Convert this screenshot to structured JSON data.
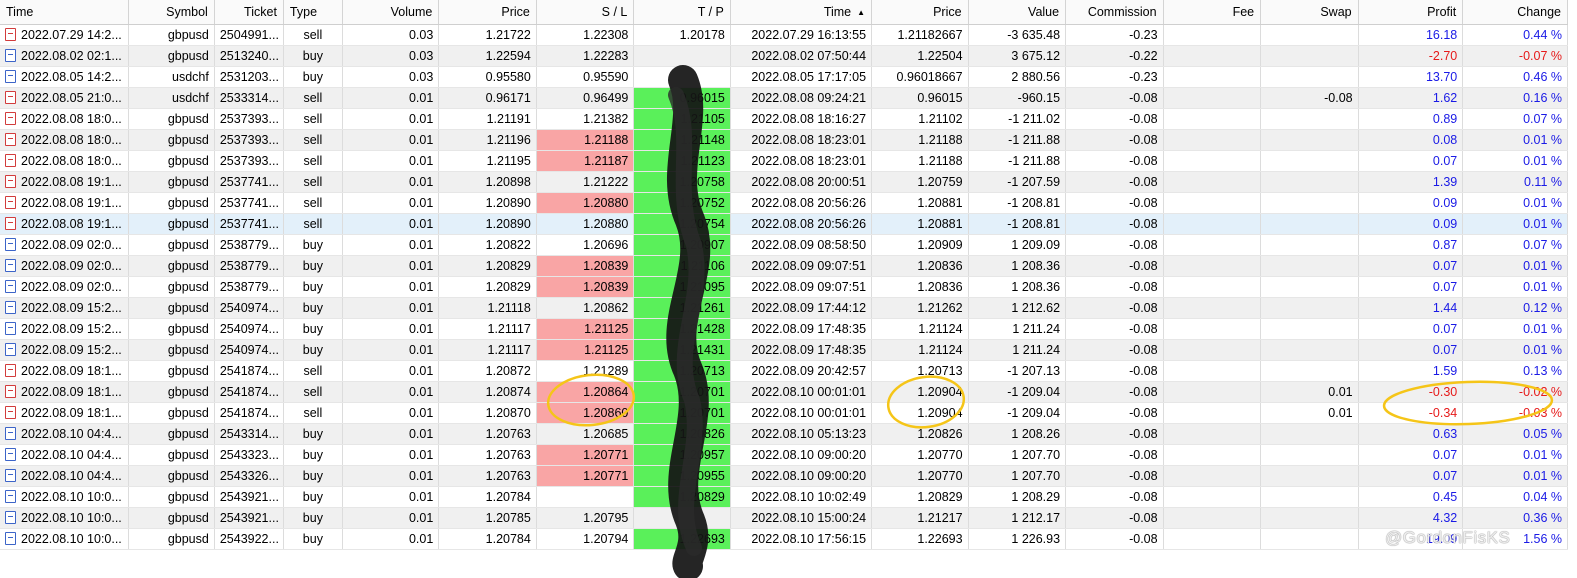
{
  "headers": {
    "time": "Time",
    "symbol": "Symbol",
    "ticket": "Ticket",
    "type": "Type",
    "volume": "Volume",
    "price": "Price",
    "sl": "S / L",
    "tp": "T / P",
    "time2": "Time",
    "price2": "Price",
    "value": "Value",
    "commission": "Commission",
    "fee": "Fee",
    "swap": "Swap",
    "profit": "Profit",
    "change": "Change"
  },
  "sort_indicator": "▲",
  "rows": [
    {
      "time": "2022.07.29 14:2...",
      "symbol": "gbpusd",
      "ticket": "2504991...",
      "type": "sell",
      "volume": "0.03",
      "price": "1.21722",
      "sl": "1.22308",
      "tp": "1.20178",
      "time2": "2022.07.29 16:13:55",
      "price2": "1.21182667",
      "value": "-3 635.48",
      "commission": "-0.23",
      "fee": "",
      "swap": "",
      "profit": "16.18",
      "change": "0.44 %"
    },
    {
      "time": "2022.08.02 02:1...",
      "symbol": "gbpusd",
      "ticket": "2513240...",
      "type": "buy",
      "volume": "0.03",
      "price": "1.22594",
      "sl": "1.22283",
      "tp": "",
      "time2": "2022.08.02 07:50:44",
      "price2": "1.22504",
      "value": "3 675.12",
      "commission": "-0.22",
      "fee": "",
      "swap": "",
      "profit": "-2.70",
      "change": "-0.07 %"
    },
    {
      "time": "2022.08.05 14:2...",
      "symbol": "usdchf",
      "ticket": "2531203...",
      "type": "buy",
      "volume": "0.03",
      "price": "0.95580",
      "sl": "0.95590",
      "tp": "",
      "time2": "2022.08.05 17:17:05",
      "price2": "0.96018667",
      "value": "2 880.56",
      "commission": "-0.23",
      "fee": "",
      "swap": "",
      "profit": "13.70",
      "change": "0.46 %"
    },
    {
      "time": "2022.08.05 21:0...",
      "symbol": "usdchf",
      "ticket": "2533314...",
      "type": "sell",
      "volume": "0.01",
      "price": "0.96171",
      "sl": "0.96499",
      "tp": "0.96015",
      "time2": "2022.08.08 09:24:21",
      "price2": "0.96015",
      "value": "-960.15",
      "commission": "-0.08",
      "fee": "",
      "swap": "-0.08",
      "profit": "1.62",
      "change": "0.16 %"
    },
    {
      "time": "2022.08.08 18:0...",
      "symbol": "gbpusd",
      "ticket": "2537393...",
      "type": "sell",
      "volume": "0.01",
      "price": "1.21191",
      "sl": "1.21382",
      "tp": "1.21105",
      "time2": "2022.08.08 18:16:27",
      "price2": "1.21102",
      "value": "-1 211.02",
      "commission": "-0.08",
      "fee": "",
      "swap": "",
      "profit": "0.89",
      "change": "0.07 %"
    },
    {
      "time": "2022.08.08 18:0...",
      "symbol": "gbpusd",
      "ticket": "2537393...",
      "type": "sell",
      "volume": "0.01",
      "price": "1.21196",
      "sl": "1.21188",
      "tp": "1.21148",
      "time2": "2022.08.08 18:23:01",
      "price2": "1.21188",
      "value": "-1 211.88",
      "commission": "-0.08",
      "fee": "",
      "swap": "",
      "profit": "0.08",
      "change": "0.01 %"
    },
    {
      "time": "2022.08.08 18:0...",
      "symbol": "gbpusd",
      "ticket": "2537393...",
      "type": "sell",
      "volume": "0.01",
      "price": "1.21195",
      "sl": "1.21187",
      "tp": "1.21123",
      "time2": "2022.08.08 18:23:01",
      "price2": "1.21188",
      "value": "-1 211.88",
      "commission": "-0.08",
      "fee": "",
      "swap": "",
      "profit": "0.07",
      "change": "0.01 %"
    },
    {
      "time": "2022.08.08 19:1...",
      "symbol": "gbpusd",
      "ticket": "2537741...",
      "type": "sell",
      "volume": "0.01",
      "price": "1.20898",
      "sl": "1.21222",
      "tp": "1.20758",
      "time2": "2022.08.08 20:00:51",
      "price2": "1.20759",
      "value": "-1 207.59",
      "commission": "-0.08",
      "fee": "",
      "swap": "",
      "profit": "1.39",
      "change": "0.11 %"
    },
    {
      "time": "2022.08.08 19:1...",
      "symbol": "gbpusd",
      "ticket": "2537741...",
      "type": "sell",
      "volume": "0.01",
      "price": "1.20890",
      "sl": "1.20880",
      "tp": "1.20752",
      "time2": "2022.08.08 20:56:26",
      "price2": "1.20881",
      "value": "-1 208.81",
      "commission": "-0.08",
      "fee": "",
      "swap": "",
      "profit": "0.09",
      "change": "0.01 %"
    },
    {
      "time": "2022.08.08 19:1...",
      "symbol": "gbpusd",
      "ticket": "2537741...",
      "type": "sell",
      "volume": "0.01",
      "price": "1.20890",
      "sl": "1.20880",
      "tp": "1.20754",
      "time2": "2022.08.08 20:56:26",
      "price2": "1.20881",
      "value": "-1 208.81",
      "commission": "-0.08",
      "fee": "",
      "swap": "",
      "profit": "0.09",
      "change": "0.01 %"
    },
    {
      "time": "2022.08.09 02:0...",
      "symbol": "gbpusd",
      "ticket": "2538779...",
      "type": "buy",
      "volume": "0.01",
      "price": "1.20822",
      "sl": "1.20696",
      "tp": "1.20907",
      "time2": "2022.08.09 08:58:50",
      "price2": "1.20909",
      "value": "1 209.09",
      "commission": "-0.08",
      "fee": "",
      "swap": "",
      "profit": "0.87",
      "change": "0.07 %"
    },
    {
      "time": "2022.08.09 02:0...",
      "symbol": "gbpusd",
      "ticket": "2538779...",
      "type": "buy",
      "volume": "0.01",
      "price": "1.20829",
      "sl": "1.20839",
      "tp": "1.21106",
      "time2": "2022.08.09 09:07:51",
      "price2": "1.20836",
      "value": "1 208.36",
      "commission": "-0.08",
      "fee": "",
      "swap": "",
      "profit": "0.07",
      "change": "0.01 %"
    },
    {
      "time": "2022.08.09 02:0...",
      "symbol": "gbpusd",
      "ticket": "2538779...",
      "type": "buy",
      "volume": "0.01",
      "price": "1.20829",
      "sl": "1.20839",
      "tp": "1.21095",
      "time2": "2022.08.09 09:07:51",
      "price2": "1.20836",
      "value": "1 208.36",
      "commission": "-0.08",
      "fee": "",
      "swap": "",
      "profit": "0.07",
      "change": "0.01 %"
    },
    {
      "time": "2022.08.09 15:2...",
      "symbol": "gbpusd",
      "ticket": "2540974...",
      "type": "buy",
      "volume": "0.01",
      "price": "1.21118",
      "sl": "1.20862",
      "tp": "1.21261",
      "time2": "2022.08.09 17:44:12",
      "price2": "1.21262",
      "value": "1 212.62",
      "commission": "-0.08",
      "fee": "",
      "swap": "",
      "profit": "1.44",
      "change": "0.12 %"
    },
    {
      "time": "2022.08.09 15:2...",
      "symbol": "gbpusd",
      "ticket": "2540974...",
      "type": "buy",
      "volume": "0.01",
      "price": "1.21117",
      "sl": "1.21125",
      "tp": "1.21428",
      "time2": "2022.08.09 17:48:35",
      "price2": "1.21124",
      "value": "1 211.24",
      "commission": "-0.08",
      "fee": "",
      "swap": "",
      "profit": "0.07",
      "change": "0.01 %"
    },
    {
      "time": "2022.08.09 15:2...",
      "symbol": "gbpusd",
      "ticket": "2540974...",
      "type": "buy",
      "volume": "0.01",
      "price": "1.21117",
      "sl": "1.21125",
      "tp": "1.21431",
      "time2": "2022.08.09 17:48:35",
      "price2": "1.21124",
      "value": "1 211.24",
      "commission": "-0.08",
      "fee": "",
      "swap": "",
      "profit": "0.07",
      "change": "0.01 %"
    },
    {
      "time": "2022.08.09 18:1...",
      "symbol": "gbpusd",
      "ticket": "2541874...",
      "type": "sell",
      "volume": "0.01",
      "price": "1.20872",
      "sl": "1.21289",
      "tp": "1.20713",
      "time2": "2022.08.09 20:42:57",
      "price2": "1.20713",
      "value": "-1 207.13",
      "commission": "-0.08",
      "fee": "",
      "swap": "",
      "profit": "1.59",
      "change": "0.13 %"
    },
    {
      "time": "2022.08.09 18:1...",
      "symbol": "gbpusd",
      "ticket": "2541874...",
      "type": "sell",
      "volume": "0.01",
      "price": "1.20874",
      "sl": "1.20864",
      "tp": "1.20701",
      "time2": "2022.08.10 00:01:01",
      "price2": "1.20904",
      "value": "-1 209.04",
      "commission": "-0.08",
      "fee": "",
      "swap": "0.01",
      "profit": "-0.30",
      "change": "-0.02 %"
    },
    {
      "time": "2022.08.09 18:1...",
      "symbol": "gbpusd",
      "ticket": "2541874...",
      "type": "sell",
      "volume": "0.01",
      "price": "1.20870",
      "sl": "1.20860",
      "tp": "1.20701",
      "time2": "2022.08.10 00:01:01",
      "price2": "1.20904",
      "value": "-1 209.04",
      "commission": "-0.08",
      "fee": "",
      "swap": "0.01",
      "profit": "-0.34",
      "change": "-0.03 %"
    },
    {
      "time": "2022.08.10 04:4...",
      "symbol": "gbpusd",
      "ticket": "2543314...",
      "type": "buy",
      "volume": "0.01",
      "price": "1.20763",
      "sl": "1.20685",
      "tp": "1.20826",
      "time2": "2022.08.10 05:13:23",
      "price2": "1.20826",
      "value": "1 208.26",
      "commission": "-0.08",
      "fee": "",
      "swap": "",
      "profit": "0.63",
      "change": "0.05 %"
    },
    {
      "time": "2022.08.10 04:4...",
      "symbol": "gbpusd",
      "ticket": "2543323...",
      "type": "buy",
      "volume": "0.01",
      "price": "1.20763",
      "sl": "1.20771",
      "tp": "1.20957",
      "time2": "2022.08.10 09:00:20",
      "price2": "1.20770",
      "value": "1 207.70",
      "commission": "-0.08",
      "fee": "",
      "swap": "",
      "profit": "0.07",
      "change": "0.01 %"
    },
    {
      "time": "2022.08.10 04:4...",
      "symbol": "gbpusd",
      "ticket": "2543326...",
      "type": "buy",
      "volume": "0.01",
      "price": "1.20763",
      "sl": "1.20771",
      "tp": "1.20955",
      "time2": "2022.08.10 09:00:20",
      "price2": "1.20770",
      "value": "1 207.70",
      "commission": "-0.08",
      "fee": "",
      "swap": "",
      "profit": "0.07",
      "change": "0.01 %"
    },
    {
      "time": "2022.08.10 10:0...",
      "symbol": "gbpusd",
      "ticket": "2543921...",
      "type": "buy",
      "volume": "0.01",
      "price": "1.20784",
      "sl": "",
      "tp": "1.20829",
      "time2": "2022.08.10 10:02:49",
      "price2": "1.20829",
      "value": "1 208.29",
      "commission": "-0.08",
      "fee": "",
      "swap": "",
      "profit": "0.45",
      "change": "0.04 %"
    },
    {
      "time": "2022.08.10 10:0...",
      "symbol": "gbpusd",
      "ticket": "2543921...",
      "type": "buy",
      "volume": "0.01",
      "price": "1.20785",
      "sl": "1.20795",
      "tp": "",
      "time2": "2022.08.10 15:00:24",
      "price2": "1.21217",
      "value": "1 212.17",
      "commission": "-0.08",
      "fee": "",
      "swap": "",
      "profit": "4.32",
      "change": "0.36 %"
    },
    {
      "time": "2022.08.10 10:0...",
      "symbol": "gbpusd",
      "ticket": "2543922...",
      "type": "buy",
      "volume": "0.01",
      "price": "1.20784",
      "sl": "1.20794",
      "tp": "1.22693",
      "time2": "2022.08.10 17:56:15",
      "price2": "1.22693",
      "value": "1 226.93",
      "commission": "-0.08",
      "fee": "",
      "swap": "",
      "profit": "19.09",
      "change": "1.56 %"
    }
  ],
  "sl_highlight_rows": [
    5,
    6,
    8,
    11,
    12,
    14,
    15,
    17,
    18,
    20,
    21
  ],
  "tp_highlight_rows": [
    3,
    4,
    5,
    6,
    7,
    8,
    9,
    10,
    11,
    12,
    13,
    14,
    15,
    16,
    17,
    18,
    19,
    20,
    21,
    22,
    24
  ],
  "selected_row": 9,
  "colors": {
    "sl_red": "#f9a5a5",
    "tp_green": "#5af05a",
    "profit_pos": "#1a1ae6",
    "profit_neg": "#e61a1a",
    "annotation": "#f5c518",
    "selected": "#e3f0fa"
  },
  "icons": {
    "sell": "sell-order-icon",
    "buy": "buy-order-icon"
  },
  "watermark": "@GordonFisKS"
}
